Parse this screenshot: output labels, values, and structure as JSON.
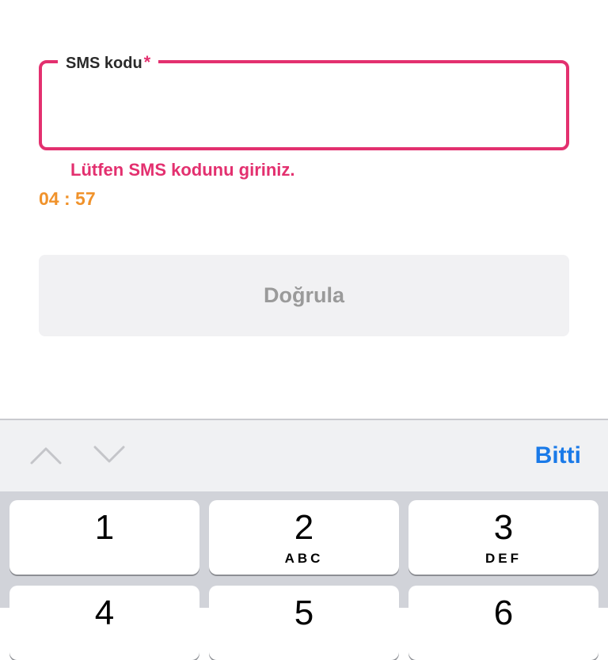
{
  "field": {
    "label": "SMS kodu",
    "required_mark": "*",
    "value": ""
  },
  "error_message": "Lütfen SMS kodunu giriniz.",
  "timer": "04 : 57",
  "verify_button": "Doğrula",
  "toolbar": {
    "done_label": "Bitti",
    "prev_icon": "chevron-up-icon",
    "next_icon": "chevron-down-icon"
  },
  "keypad": {
    "row1": [
      {
        "digit": "1",
        "letters": ""
      },
      {
        "digit": "2",
        "letters": "ABC"
      },
      {
        "digit": "3",
        "letters": "DEF"
      }
    ],
    "row2": [
      {
        "digit": "4",
        "letters": ""
      },
      {
        "digit": "5",
        "letters": ""
      },
      {
        "digit": "6",
        "letters": ""
      }
    ]
  },
  "colors": {
    "error_accent": "#e3306f",
    "timer": "#f0922b",
    "link_blue": "#1a7ae8",
    "button_disabled_bg": "#f1f1f3"
  }
}
